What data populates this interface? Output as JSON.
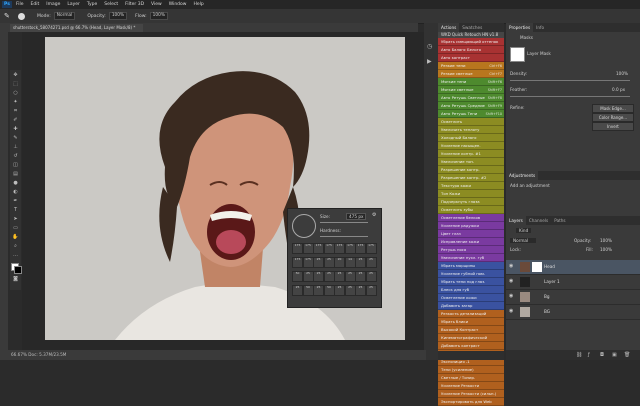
{
  "app": {
    "logo": "Ps"
  },
  "menu": [
    "File",
    "Edit",
    "Image",
    "Layer",
    "Type",
    "Select",
    "Filter 3D",
    "View",
    "Window",
    "Help"
  ],
  "options": {
    "mode_label": "Mode:",
    "mode_value": "Normal",
    "opacity_label": "Opacity:",
    "opacity_value": "100%",
    "flow_label": "Flow:",
    "flow_value": "100%"
  },
  "document": {
    "tab_title": "shutterstock_58074271.psd @ 66.7% (Head, Layer Mask/8) *",
    "status": "66.67%   Doc: 5.37M/23.5M"
  },
  "brush": {
    "size_label": "Size:",
    "size_value": "475 px",
    "hardness_label": "Hardness:",
    "presets": [
      "175",
      "175",
      "175",
      "175",
      "175",
      "175",
      "175",
      "175",
      "175",
      "175",
      "25",
      "25",
      "20",
      "14",
      "25",
      "25",
      "50",
      "25",
      "25",
      "25",
      "25",
      "25",
      "25",
      "25",
      "25",
      "50",
      "25",
      "50",
      "25",
      "25",
      "25",
      "25"
    ]
  },
  "actions_panel": {
    "tabs": [
      "Actions",
      "Swatches"
    ],
    "header": "WKD Quick Retouch HN v1.8",
    "items": [
      {
        "label": "Убрать смещающий оттенок",
        "key": "",
        "color": "#a83232"
      },
      {
        "label": "Авто Баланс Белого",
        "key": "",
        "color": "#a83232"
      },
      {
        "label": "Авто контраст",
        "key": "",
        "color": "#a83232"
      },
      {
        "label": "Резкие тени",
        "key": "Ctrl+F6",
        "color": "#b8761e"
      },
      {
        "label": "Резкие светлые",
        "key": "Ctrl+F7",
        "color": "#b8761e"
      },
      {
        "label": "Мягкие тени",
        "key": "Shift+F6",
        "color": "#4e8a2e"
      },
      {
        "label": "Мягкие светлые",
        "key": "Shift+F7",
        "color": "#4e8a2e"
      },
      {
        "label": "Авто Ретушь Светлые",
        "key": "Shift+F8",
        "color": "#4e8a2e"
      },
      {
        "label": "Авто Ретушь Средние",
        "key": "Shift+F9",
        "color": "#4e8a2e"
      },
      {
        "label": "Авто Ретушь Тени",
        "key": "Shift+F10",
        "color": "#4e8a2e"
      },
      {
        "label": "Осветлить",
        "key": "",
        "color": "#8c8c22"
      },
      {
        "label": "Увеличить теплоту",
        "key": "",
        "color": "#8c8c22"
      },
      {
        "label": "Холодный Баланс",
        "key": "",
        "color": "#8c8c22"
      },
      {
        "label": "Усиление насыщен.",
        "key": "",
        "color": "#8c8c22"
      },
      {
        "label": "Усиление контр. #1",
        "key": "",
        "color": "#8c8c22"
      },
      {
        "label": "Увеличение тон.",
        "key": "",
        "color": "#8c8c22"
      },
      {
        "label": "Разрешение контр.",
        "key": "",
        "color": "#8c8c22"
      },
      {
        "label": "Разрешение контр. #2",
        "key": "",
        "color": "#8c8c22"
      },
      {
        "label": "Текстура кожи",
        "key": "",
        "color": "#8c8c22"
      },
      {
        "label": "Тон Кожи",
        "key": "",
        "color": "#8c8c22"
      },
      {
        "label": "Подчеркнуть глаза",
        "key": "",
        "color": "#8c8c22"
      },
      {
        "label": "Осветлить зубы",
        "key": "",
        "color": "#8c8c22"
      },
      {
        "label": "Осветление белков",
        "key": "",
        "color": "#7a3aa0"
      },
      {
        "label": "Усиление радужки",
        "key": "",
        "color": "#7a3aa0"
      },
      {
        "label": "Цвет глаз",
        "key": "",
        "color": "#7a3aa0"
      },
      {
        "label": "Исправление кожи",
        "key": "",
        "color": "#7a3aa0"
      },
      {
        "label": "Ретушь носа",
        "key": "",
        "color": "#7a3aa0"
      },
      {
        "label": "Увеличение пухл. губ",
        "key": "",
        "color": "#7a3aa0"
      },
      {
        "label": "Убрать морщины",
        "key": "",
        "color": "#3a52a0"
      },
      {
        "label": "Усиление губной пом.",
        "key": "",
        "color": "#3a52a0"
      },
      {
        "label": "Убрать тени под глаз.",
        "key": "",
        "color": "#3a52a0"
      },
      {
        "label": "Блеск для губ",
        "key": "",
        "color": "#3a52a0"
      },
      {
        "label": "Осветление кожи",
        "key": "",
        "color": "#3a52a0"
      },
      {
        "label": "Добавить загар",
        "key": "",
        "color": "#3a52a0"
      },
      {
        "label": "Резкость детализаций",
        "key": "",
        "color": "#b0601e"
      },
      {
        "label": "Убрать блики",
        "key": "",
        "color": "#b0601e"
      },
      {
        "label": "Высокий Контраст",
        "key": "",
        "color": "#b0601e"
      },
      {
        "label": "Кинематографический",
        "key": "",
        "color": "#b0601e"
      },
      {
        "label": "Добавить контраст",
        "key": "",
        "color": "#b0601e"
      },
      {
        "label": "Экспозиция +1",
        "key": "",
        "color": "#b0601e"
      },
      {
        "label": "Экспозиция -1",
        "key": "",
        "color": "#b0601e"
      },
      {
        "label": "Тени (усиление)",
        "key": "",
        "color": "#b0601e"
      },
      {
        "label": "Светлые / Тонир.",
        "key": "",
        "color": "#b0601e"
      },
      {
        "label": "Усиление Резкости",
        "key": "",
        "color": "#b0601e"
      },
      {
        "label": "Усиление Резкости (сильн.)",
        "key": "",
        "color": "#b0601e"
      },
      {
        "label": "Экспортировать для Web",
        "key": "",
        "color": "#b0601e"
      }
    ]
  },
  "properties_panel": {
    "tabs": [
      "Properties",
      "Info"
    ],
    "masks_label": "Masks",
    "mask_type": "Layer Mask",
    "density_label": "Density:",
    "density_value": "100%",
    "feather_label": "Feather:",
    "feather_value": "0.0 px",
    "refine_label": "Refine:",
    "btn_mask_edge": "Mask Edge...",
    "btn_color_range": "Color Range...",
    "btn_invert": "Invert"
  },
  "adjustments_panel": {
    "tab": "Adjustments",
    "add_label": "Add an adjustment"
  },
  "layers_panel": {
    "tabs": [
      "Layers",
      "Channels",
      "Paths"
    ],
    "kind_label": "Kind",
    "blend_mode": "Normal",
    "opacity_label": "Opacity:",
    "opacity_value": "100%",
    "lock_label": "Lock:",
    "fill_label": "Fill:",
    "fill_value": "100%",
    "layers": [
      {
        "name": "Head"
      },
      {
        "name": "Layer 1"
      },
      {
        "name": "Bg"
      },
      {
        "name": "BG"
      }
    ]
  },
  "colors": {
    "accent": "#31a8ff",
    "panel_bg": "#3a3a3a",
    "canvas_bg": "#cbc9c5"
  }
}
